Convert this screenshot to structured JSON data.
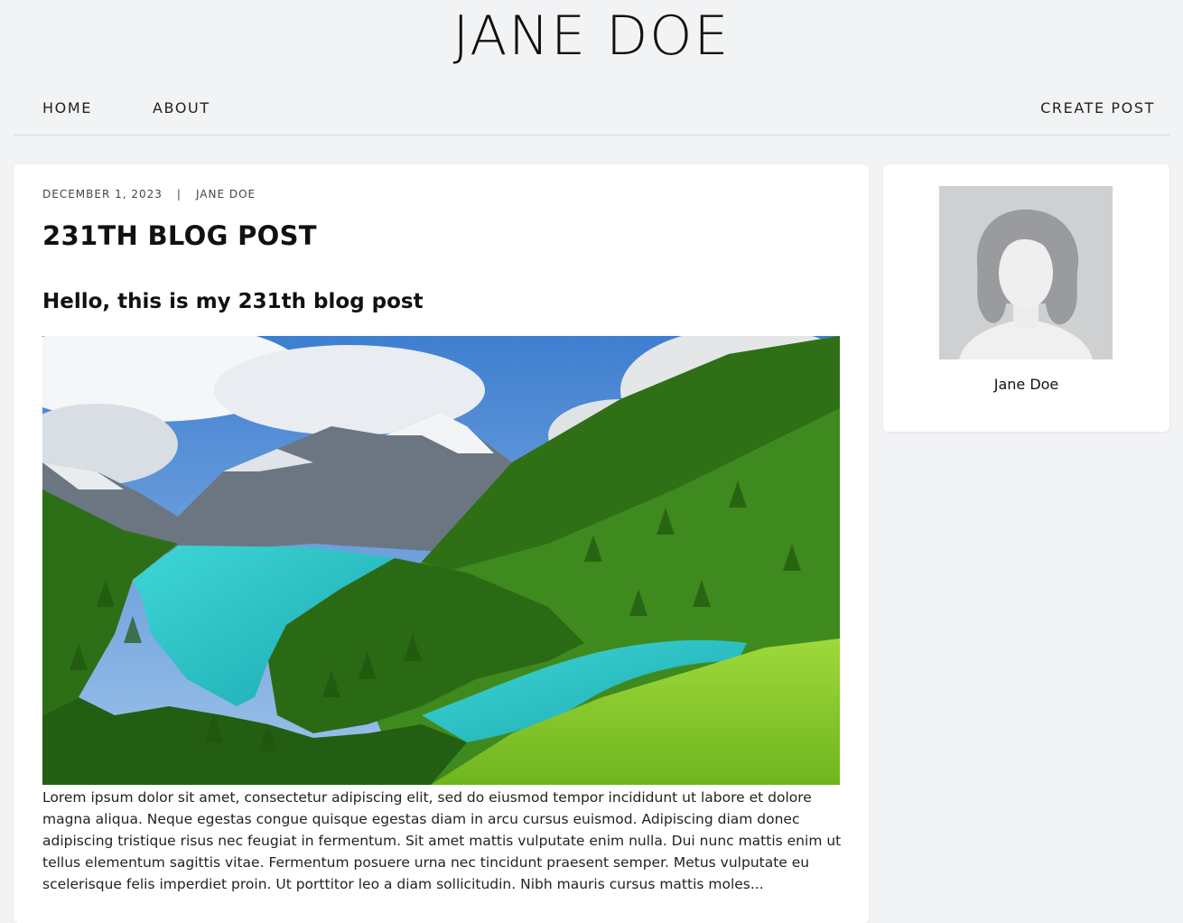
{
  "site": {
    "title": "JANE DOE"
  },
  "nav": {
    "home": "HOME",
    "about": "ABOUT",
    "create_post": "CREATE POST"
  },
  "post": {
    "date": "DECEMBER 1, 2023",
    "separator": "|",
    "author": "JANE DOE",
    "title": "231TH BLOG POST",
    "subtitle": "Hello, this is my 231th blog post",
    "image_alt_icon": "landscape-image",
    "body": "Lorem ipsum dolor sit amet, consectetur adipiscing elit, sed do eiusmod tempor incididunt ut labore et dolore magna aliqua. Neque egestas congue quisque egestas diam in arcu cursus euismod. Adipiscing diam donec adipiscing tristique risus nec feugiat in fermentum. Sit amet mattis vulputate enim nulla. Dui nunc mattis enim ut tellus elementum sagittis vitae. Fermentum posuere urna nec tincidunt praesent semper. Metus vulputate eu scelerisque felis imperdiet proin. Ut porttitor leo a diam sollicitudin. Nibh mauris cursus mattis moles..."
  },
  "profile": {
    "avatar_icon": "person-silhouette-icon",
    "name": "Jane Doe"
  },
  "colors": {
    "background": "#f2f3f5",
    "card": "#ffffff",
    "text": "#111111",
    "avatar_bg": "#cfd0d2"
  }
}
